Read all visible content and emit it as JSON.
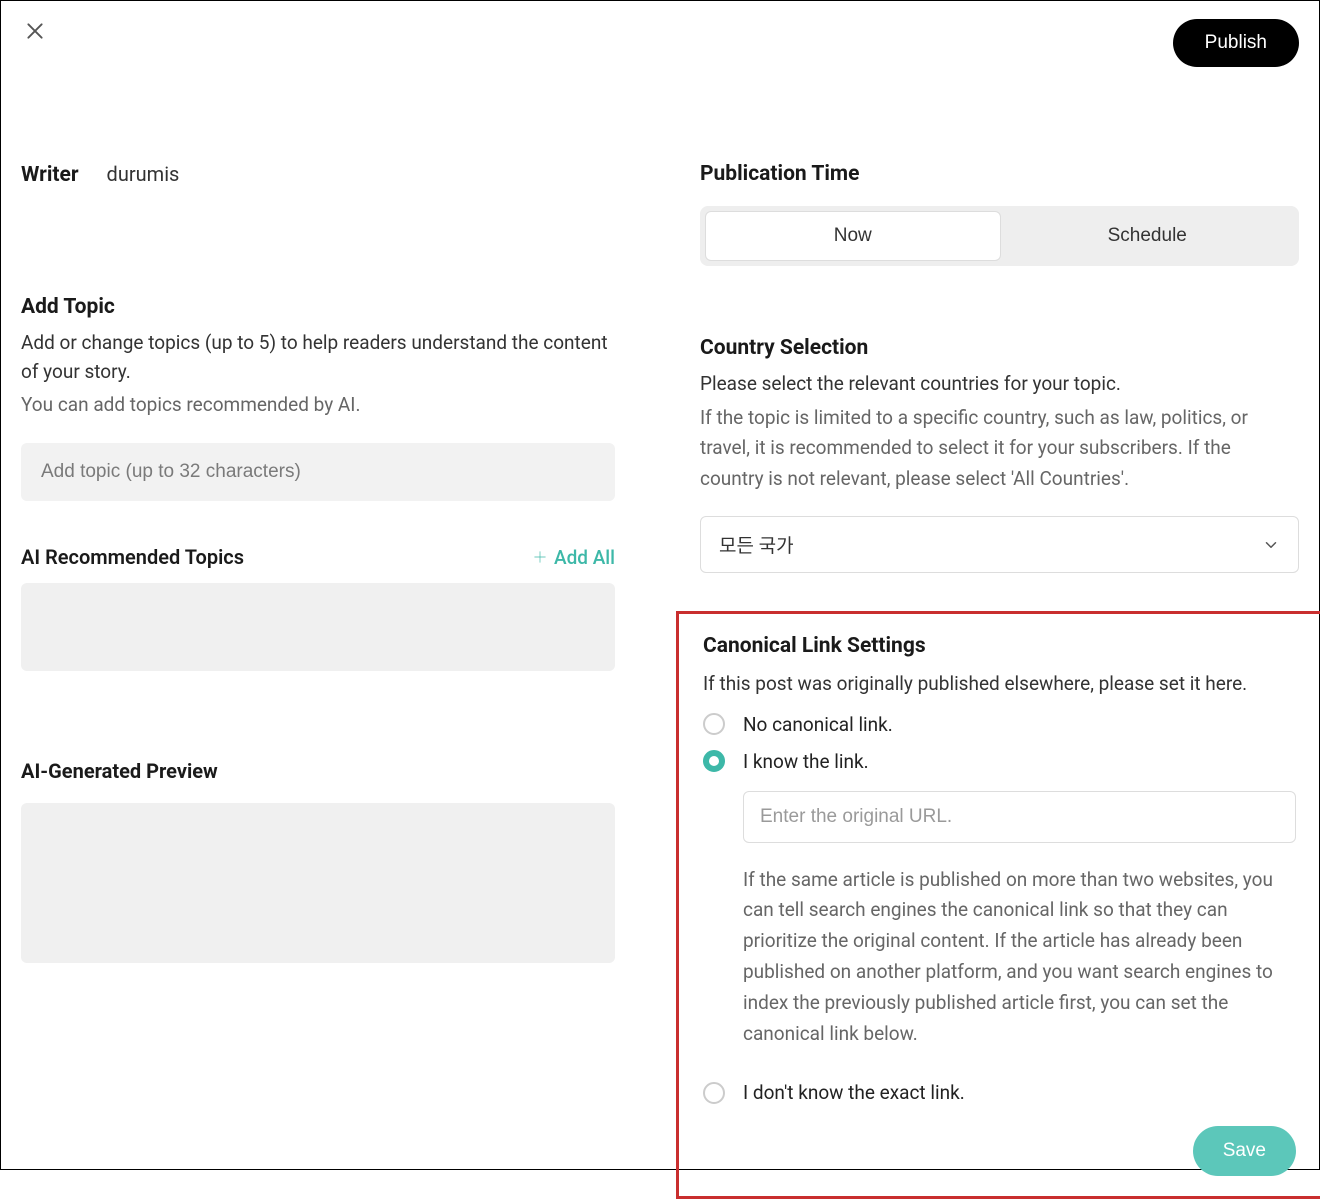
{
  "header": {
    "publish_label": "Publish"
  },
  "writer": {
    "label": "Writer",
    "name": "durumis"
  },
  "add_topic": {
    "title": "Add Topic",
    "desc": "Add or change topics (up to 5) to help readers understand the content of your story.",
    "hint": "You can add topics recommended by AI.",
    "placeholder": "Add topic (up to 32 characters)"
  },
  "ai_recommended": {
    "title": "AI Recommended Topics",
    "add_all_label": "Add All"
  },
  "ai_preview": {
    "title": "AI-Generated Preview"
  },
  "publication_time": {
    "title": "Publication Time",
    "now_label": "Now",
    "schedule_label": "Schedule"
  },
  "country": {
    "title": "Country Selection",
    "desc1": "Please select the relevant countries for your topic.",
    "desc2": "If the topic is limited to a specific country, such as law, politics, or travel, it is recommended to select it for your subscribers. If the country is not relevant, please select 'All Countries'.",
    "selected": "모든 국가"
  },
  "canonical": {
    "title": "Canonical Link Settings",
    "desc": "If this post was originally published elsewhere, please set it here.",
    "option_none": "No canonical link.",
    "option_know": "I know the link.",
    "url_placeholder": "Enter the original URL.",
    "explain": "If the same article is published on more than two websites, you can tell search engines the canonical link so that they can prioritize the original content. If the article has already been published on another platform, and you want search engines to index the previously published article first, you can set the canonical link below.",
    "option_unknown": "I don't know the exact link.",
    "save_label": "Save"
  }
}
